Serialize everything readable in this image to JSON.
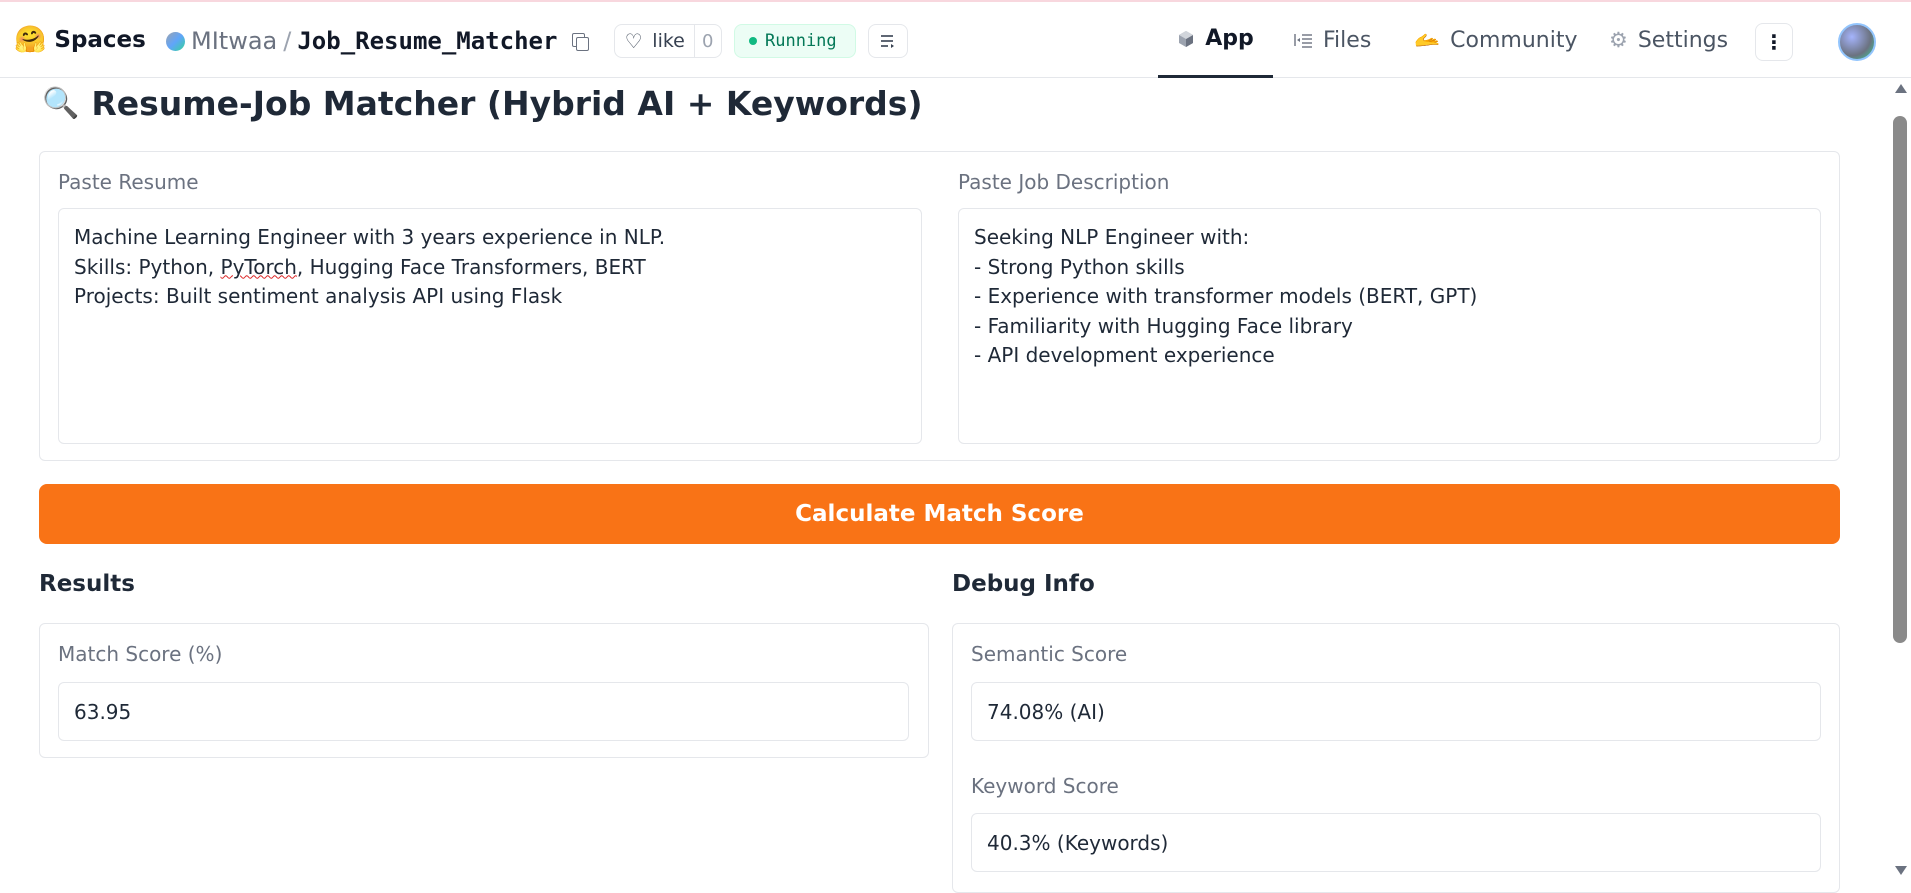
{
  "header": {
    "brand_label": "Spaces",
    "owner": "MItwaa",
    "separator": "/",
    "repo_name": "Job_Resume_Matcher",
    "like_label": "like",
    "like_count": "0",
    "status_label": "Running",
    "status_color": "#10b981",
    "nav": {
      "app": "App",
      "files": "Files",
      "community": "Community",
      "settings": "Settings"
    },
    "more_label": "⋮"
  },
  "main": {
    "title": "Resume-Job Matcher (Hybrid AI + Keywords)",
    "title_icon": "magnifying-glass-icon",
    "resume": {
      "label": "Paste Resume",
      "line1": "Machine Learning Engineer with 3 years experience in NLP.",
      "line2_before": "Skills: Python, ",
      "line2_misspelled": "PyTorch",
      "line2_after": ", Hugging Face Transformers, BERT",
      "line3": "Projects: Built sentiment analysis API using Flask"
    },
    "job": {
      "label": "Paste Job Description",
      "text": "Seeking NLP Engineer with:\n- Strong Python skills\n- Experience with transformer models (BERT, GPT)\n- Familiarity with Hugging Face library\n- API development experience"
    },
    "calculate_button": "Calculate Match Score",
    "accent_color": "#f97316",
    "results": {
      "heading": "Results",
      "match_label": "Match Score (%)",
      "match_value": "63.95"
    },
    "debug": {
      "heading": "Debug Info",
      "semantic_label": "Semantic Score",
      "semantic_value": "74.08% (AI)",
      "keyword_label": "Keyword Score",
      "keyword_value": "40.3% (Keywords)"
    }
  }
}
